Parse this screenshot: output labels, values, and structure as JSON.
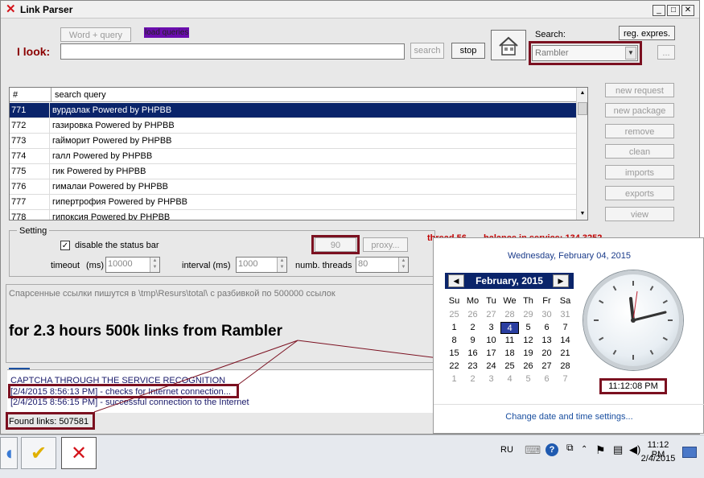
{
  "window": {
    "title": "Link Parser",
    "minimize": "_",
    "maximize": "□",
    "close": "✕"
  },
  "toolbar": {
    "look_label": "I look:",
    "word_query_label": "Word + query",
    "load_queries_label": "load queries",
    "search_value": "",
    "search_button": "search",
    "stop_button": "stop",
    "search_engine_label": "Search:",
    "search_engine_value": "Rambler",
    "reg_expres_button": "reg. expres.",
    "more_button": "..."
  },
  "table": {
    "headers": [
      "#",
      "search query"
    ],
    "rows": [
      {
        "n": "771",
        "q": "вурдалак Powered by PHPBB"
      },
      {
        "n": "772",
        "q": "газировка Powered by PHPBB"
      },
      {
        "n": "773",
        "q": "гайморит Powered by PHPBB"
      },
      {
        "n": "774",
        "q": "галл Powered by PHPBB"
      },
      {
        "n": "775",
        "q": "гик Powered by PHPBB"
      },
      {
        "n": "776",
        "q": "гималаи Powered by PHPBB"
      },
      {
        "n": "777",
        "q": "гипертрофия Powered by PHPBB"
      },
      {
        "n": "778",
        "q": "гипоксия Powered by PHPBB"
      }
    ]
  },
  "side_buttons": [
    "new request",
    "new package",
    "remove",
    "clean",
    "imports",
    "exports",
    "view"
  ],
  "settings": {
    "legend": "Setting",
    "disable_status_bar": "disable the status bar",
    "timeout_label": "timeout",
    "timeout_unit": "(ms)",
    "timeout_value": "10000",
    "interval_label": "interval (ms)",
    "interval_value": "1000",
    "threads_label": "numb. threads",
    "threads_value": "80",
    "ninety_button": "90",
    "proxy_button": "proxy...",
    "thread_status": "thread  56",
    "balance_status": "balance in service: 134.3252"
  },
  "log": {
    "path_note": "Спарсенные ссылки пишутся в \\tmp\\Resurs\\total\\ с разбивкой по 500000 ссылок",
    "annotation": "for 2.3 hours 500k links from Rambler",
    "lines": [
      "CAPTCHA THROUGH THE SERVICE RECOGNITION",
      "[2/4/2015 8:56:13 PM] - checks for Internet connection...",
      "[2/4/2015 8:56:15 PM] - successful connection to the Internet"
    ],
    "found_links": "Found links: 507581"
  },
  "calendar": {
    "header": "Wednesday, February 04, 2015",
    "month": "February, 2015",
    "day_names": [
      "Su",
      "Mo",
      "Tu",
      "We",
      "Th",
      "Fr",
      "Sa"
    ],
    "weeks": [
      [
        "25",
        "26",
        "27",
        "28",
        "29",
        "30",
        "31"
      ],
      [
        "1",
        "2",
        "3",
        "4",
        "5",
        "6",
        "7"
      ],
      [
        "8",
        "9",
        "10",
        "11",
        "12",
        "13",
        "14"
      ],
      [
        "15",
        "16",
        "17",
        "18",
        "19",
        "20",
        "21"
      ],
      [
        "22",
        "23",
        "24",
        "25",
        "26",
        "27",
        "28"
      ],
      [
        "1",
        "2",
        "3",
        "4",
        "5",
        "6",
        "7"
      ]
    ],
    "time": "11:12:08 PM",
    "settings_link": "Change date and time settings..."
  },
  "taskbar": {
    "lang": "RU",
    "clock_time": "11:12 PM",
    "clock_date": "2/4/2015"
  }
}
